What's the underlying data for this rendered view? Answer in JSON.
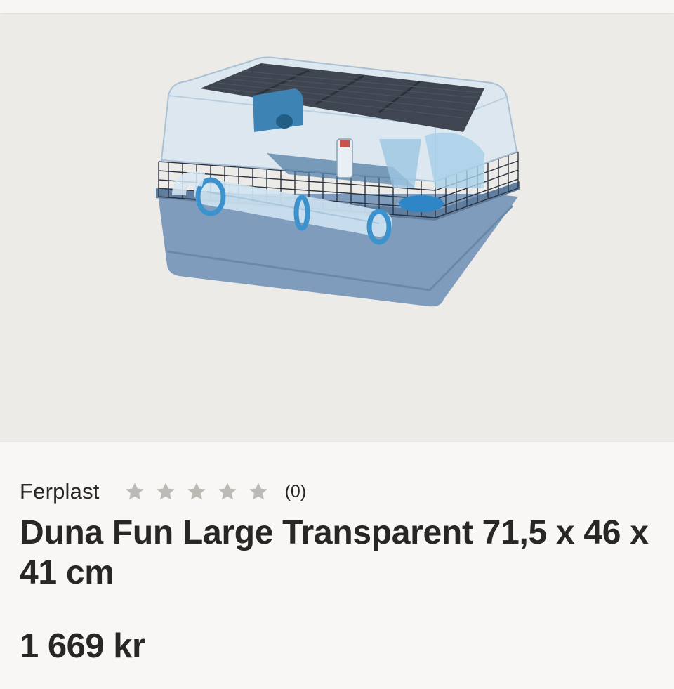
{
  "product": {
    "image_alt": "Ferplast Duna Fun Large hamster cage with transparent top, blue base and blue tubes",
    "brand": "Ferplast",
    "rating": {
      "value": 0,
      "max": 5,
      "count_label": "(0)"
    },
    "title": "Duna Fun Large Transparent 71,5 x 46 x 41 cm",
    "price": "1 669 kr"
  },
  "colors": {
    "background": "#f8f7f5",
    "image_background": "#edebe7",
    "text": "#2a2623",
    "star_empty": "#bdbab6",
    "cage_base": "#7f9cbc"
  }
}
